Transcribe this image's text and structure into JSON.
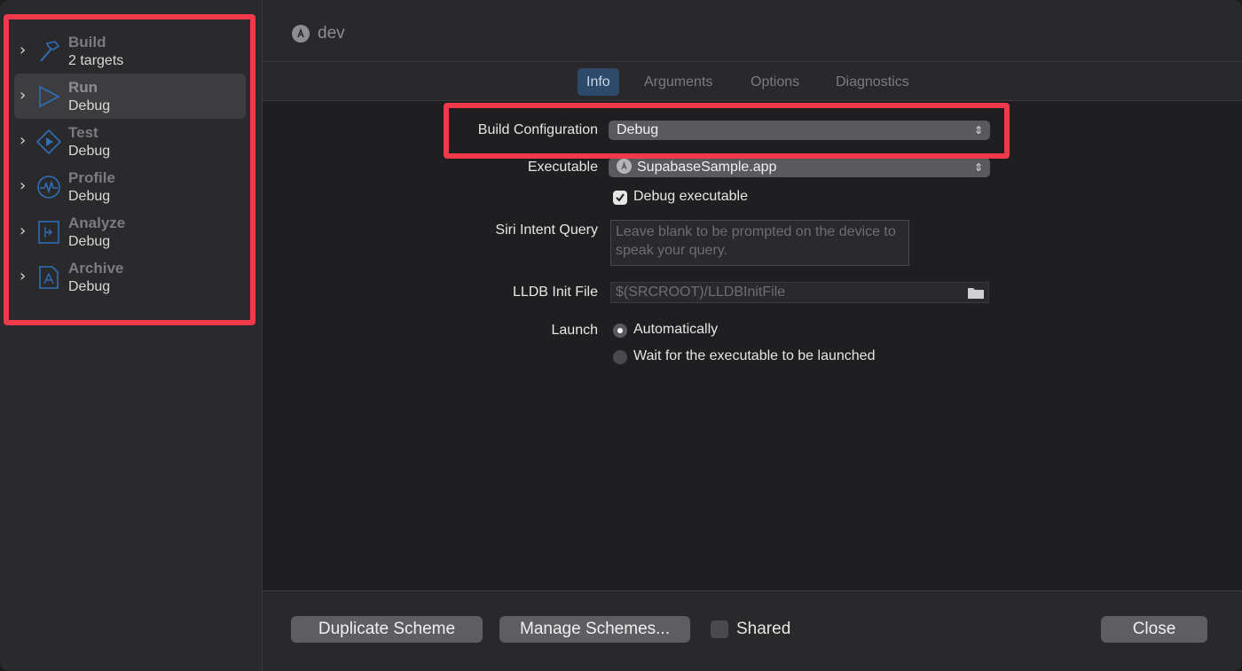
{
  "header": {
    "title": "dev",
    "icon": "app-store-icon"
  },
  "sidebar": {
    "items": [
      {
        "title": "Build",
        "subtitle": "2 targets",
        "icon": "hammer-icon",
        "selected": false
      },
      {
        "title": "Run",
        "subtitle": "Debug",
        "icon": "play-icon",
        "selected": true
      },
      {
        "title": "Test",
        "subtitle": "Debug",
        "icon": "test-diamond-icon",
        "selected": false
      },
      {
        "title": "Profile",
        "subtitle": "Debug",
        "icon": "waveform-icon",
        "selected": false
      },
      {
        "title": "Analyze",
        "subtitle": "Debug",
        "icon": "analyze-icon",
        "selected": false
      },
      {
        "title": "Archive",
        "subtitle": "Debug",
        "icon": "archive-icon",
        "selected": false
      }
    ]
  },
  "tabs": [
    {
      "label": "Info",
      "active": true
    },
    {
      "label": "Arguments",
      "active": false
    },
    {
      "label": "Options",
      "active": false
    },
    {
      "label": "Diagnostics",
      "active": false
    }
  ],
  "form": {
    "build_configuration_label": "Build Configuration",
    "build_configuration_value": "Debug",
    "executable_label": "Executable",
    "executable_value": "SupabaseSample.app",
    "debug_executable_label": "Debug executable",
    "debug_executable_checked": true,
    "siri_label": "Siri Intent Query",
    "siri_placeholder": "Leave blank to be prompted on the device to speak your query.",
    "lldb_label": "LLDB Init File",
    "lldb_placeholder": "$(SRCROOT)/LLDBInitFile",
    "launch_label": "Launch",
    "launch_options": [
      {
        "label": "Automatically",
        "selected": true
      },
      {
        "label": "Wait for the executable to be launched",
        "selected": false
      }
    ]
  },
  "footer": {
    "duplicate_label": "Duplicate Scheme",
    "manage_label": "Manage Schemes...",
    "shared_label": "Shared",
    "shared_checked": false,
    "close_label": "Close"
  },
  "colors": {
    "annotation": "#ef3a4b",
    "active_tab": "#2e4a6b",
    "icon_blue": "#2f6fb8"
  }
}
